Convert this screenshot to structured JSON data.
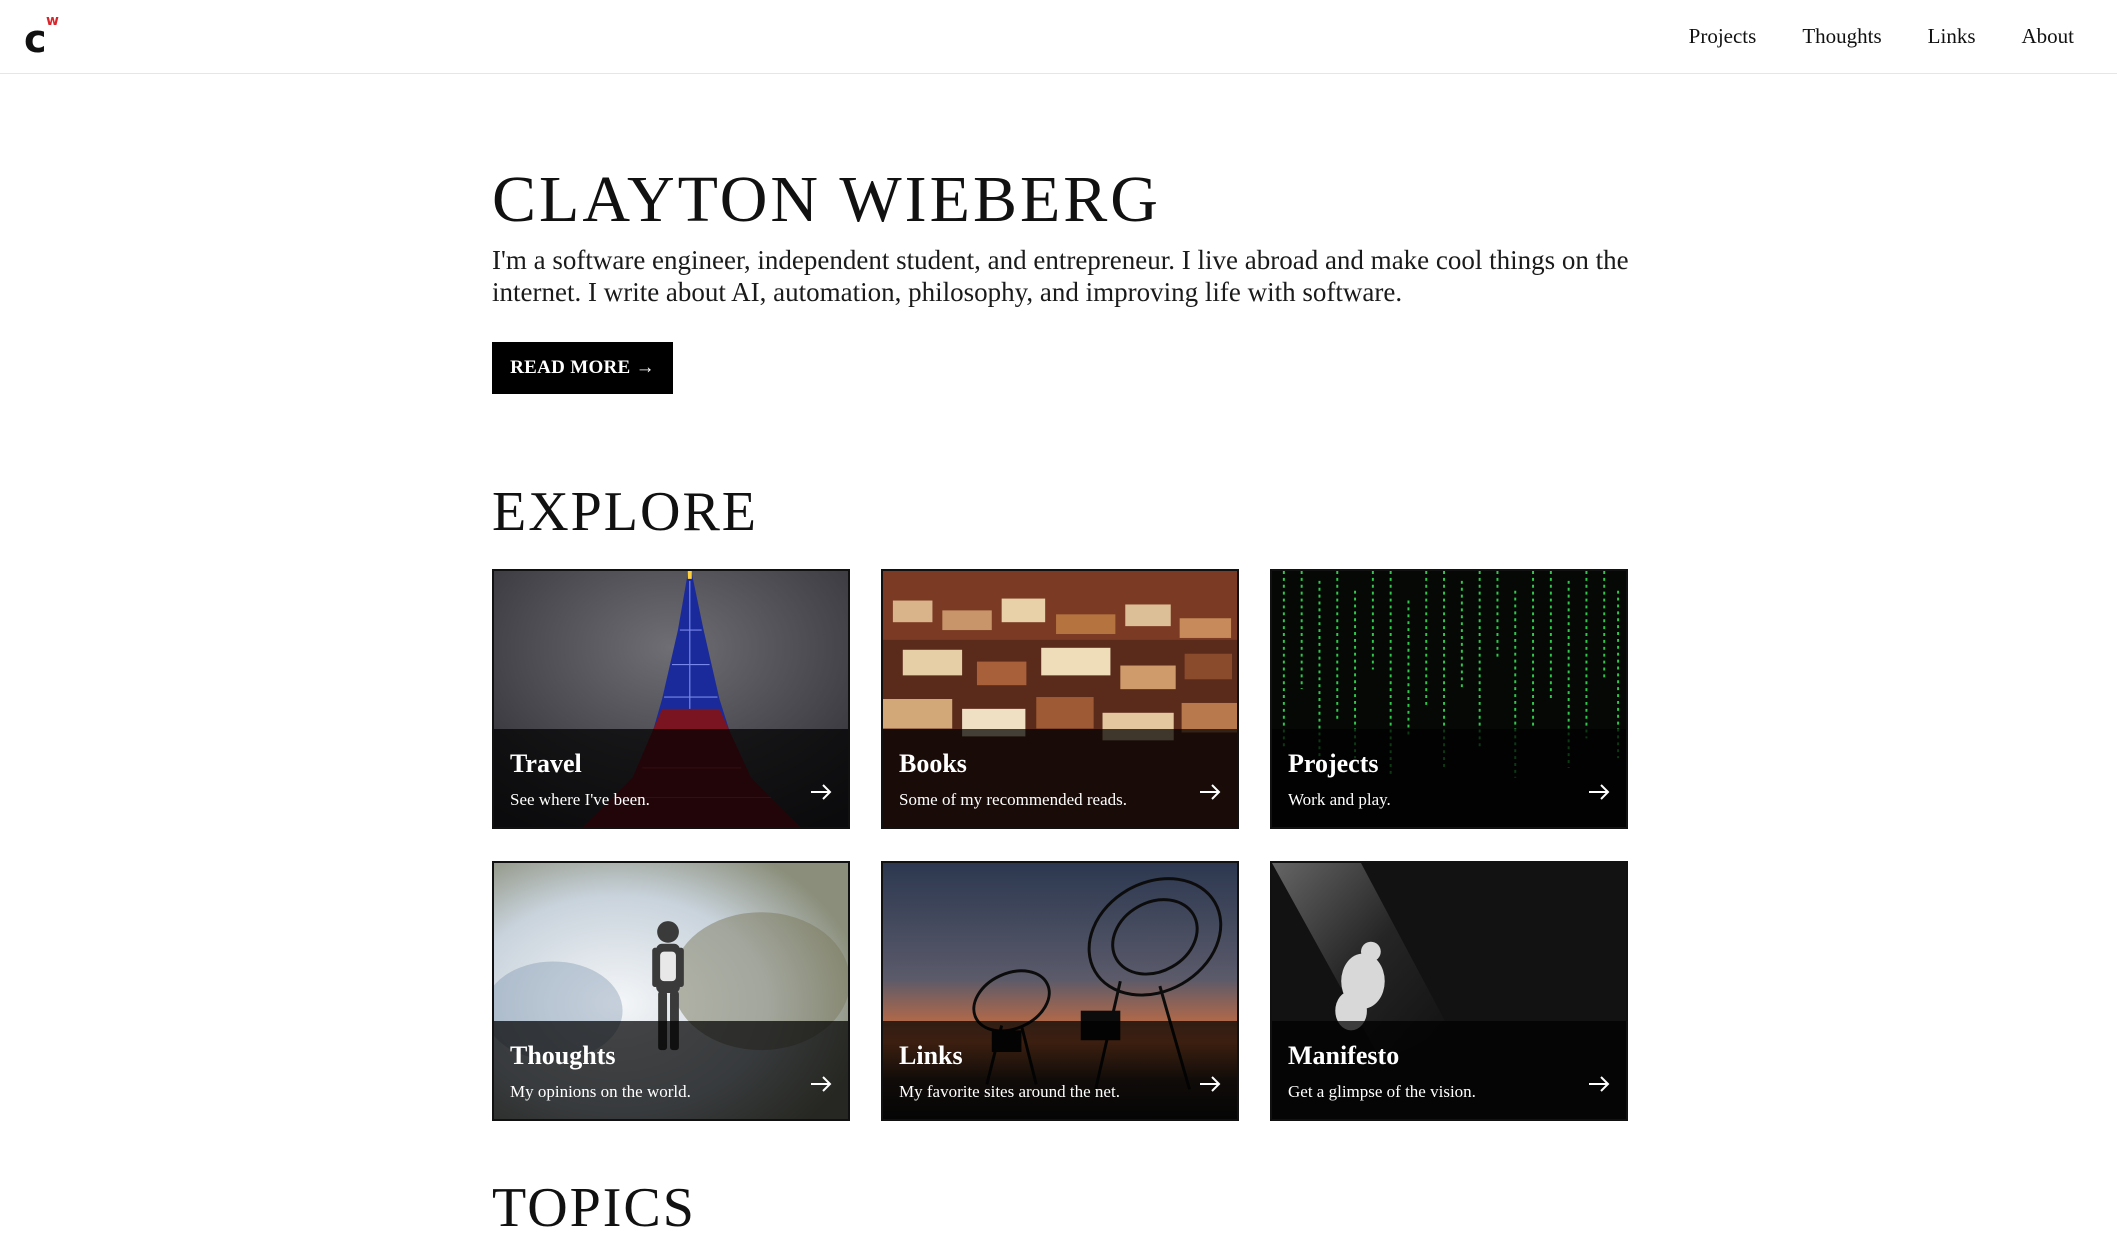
{
  "header": {
    "logo_letter": "c",
    "logo_sup": "w",
    "nav": [
      {
        "label": "Projects"
      },
      {
        "label": "Thoughts"
      },
      {
        "label": "Links"
      },
      {
        "label": "About"
      }
    ]
  },
  "hero": {
    "title": "CLAYTON WIEBERG",
    "intro": "I'm a software engineer, independent student, and entrepreneur. I live abroad and make cool things on the internet. I write about AI, automation, philosophy, and improving life with software.",
    "button_label": "READ MORE →"
  },
  "explore": {
    "title": "EXPLORE",
    "cards": [
      {
        "title": "Travel",
        "subtitle": "See where I've been.",
        "icon": "tokyo-tower-image"
      },
      {
        "title": "Books",
        "subtitle": "Some of my recommended reads.",
        "icon": "books-image"
      },
      {
        "title": "Projects",
        "subtitle": "Work and play.",
        "icon": "matrix-code-image"
      },
      {
        "title": "Thoughts",
        "subtitle": "My opinions on the world.",
        "icon": "astronaut-image"
      },
      {
        "title": "Links",
        "subtitle": "My favorite sites around the net.",
        "icon": "radio-telescope-image"
      },
      {
        "title": "Manifesto",
        "subtitle": "Get a glimpse of the vision.",
        "icon": "statue-image"
      }
    ]
  },
  "topics": {
    "title": "TOPICS"
  },
  "colors": {
    "accent": "#d8252c",
    "text": "#111111",
    "button_bg": "#000000"
  }
}
